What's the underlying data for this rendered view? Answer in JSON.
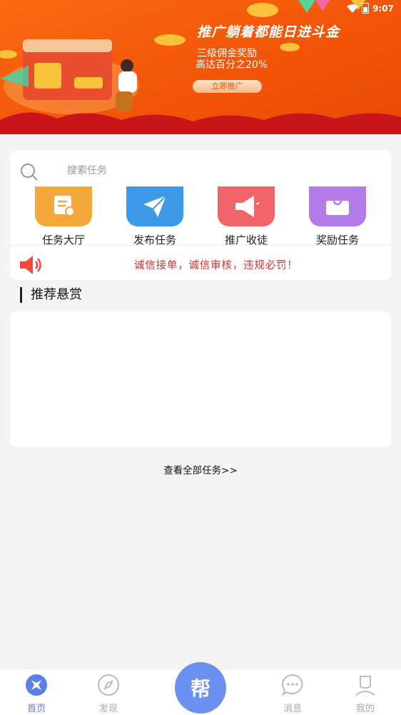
{
  "status_bar": {
    "time": "9:07"
  },
  "banner": {
    "headline": "推广躺着都能日进斗金",
    "sub1": "三级佣金奖励",
    "sub2": "高达百分之20%",
    "cta": "立即推广"
  },
  "search": {
    "placeholder": "搜索任务"
  },
  "categories": [
    {
      "label": "任务大厅",
      "color": "#f4a93a",
      "icon": "document-icon"
    },
    {
      "label": "发布任务",
      "color": "#3d9ae8",
      "icon": "paper-plane-icon"
    },
    {
      "label": "推广收徒",
      "color": "#f0646a",
      "icon": "megaphone-icon"
    },
    {
      "label": "奖励任务",
      "color": "#b57be8",
      "icon": "gift-icon"
    }
  ],
  "notice": {
    "text": "诚信接单，诚信审核，违规必罚！"
  },
  "section": {
    "title": "推荐悬赏"
  },
  "view_all": "查看全部任务>>",
  "nav": {
    "items": [
      {
        "label": "首页",
        "icon": "home-icon",
        "active": true
      },
      {
        "label": "发现",
        "icon": "compass-icon",
        "active": false
      },
      {
        "label": "消息",
        "icon": "chat-icon",
        "active": false
      },
      {
        "label": "我的",
        "icon": "user-icon",
        "active": false
      }
    ],
    "center_label": "帮"
  },
  "colors": {
    "accent": "#5a7fe6",
    "banner": "#f25508",
    "notice": "#d83232"
  }
}
